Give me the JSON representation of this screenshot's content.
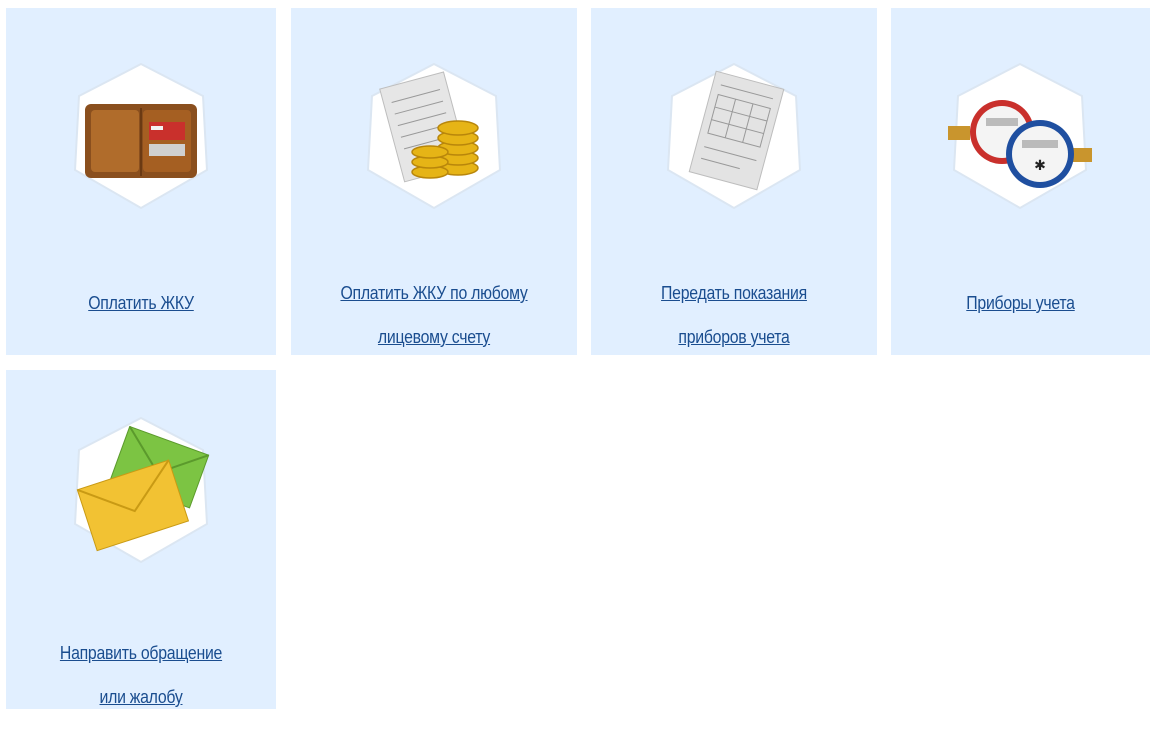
{
  "tiles": [
    {
      "label_lines": [
        "Оплатить ЖКУ"
      ],
      "icon": "wallet-icon"
    },
    {
      "label_lines": [
        "Оплатить ЖКУ по любому",
        "лицевому счету"
      ],
      "icon": "bill-with-coins-icon"
    },
    {
      "label_lines": [
        "Передать показания",
        "приборов учета"
      ],
      "icon": "meter-readings-document-icon"
    },
    {
      "label_lines": [
        "Приборы учета"
      ],
      "icon": "water-meter-icon"
    },
    {
      "label_lines": [
        "Направить обращение",
        "или жалобу"
      ],
      "icon": "envelopes-icon"
    }
  ],
  "colors": {
    "tile_bg": "#e1efff",
    "link": "#1a4d8f"
  }
}
